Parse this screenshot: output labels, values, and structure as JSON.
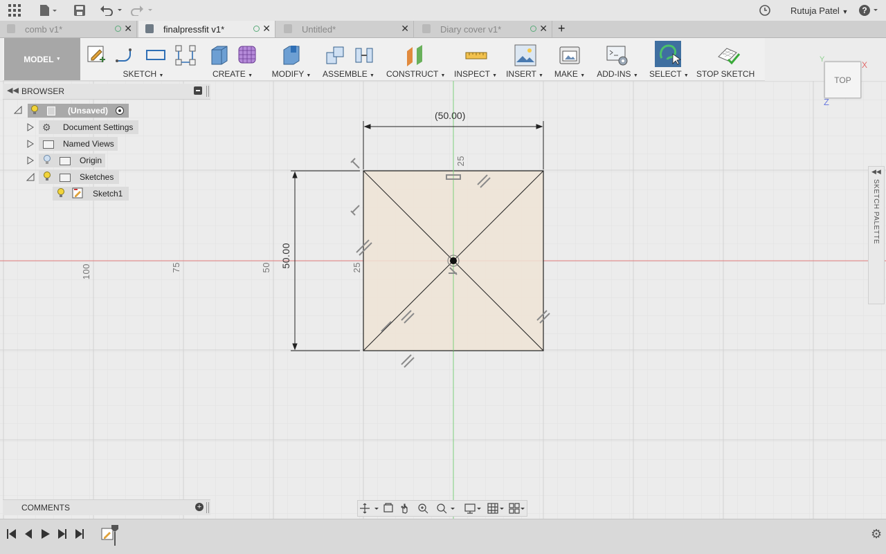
{
  "topbar": {
    "user_name": "Rutuja Patel",
    "icons": [
      "grid-apps-icon",
      "file-icon",
      "save-icon",
      "undo-icon",
      "redo-icon",
      "clock-icon",
      "help-icon"
    ]
  },
  "tabs": [
    {
      "label": "comb v1*",
      "active": false
    },
    {
      "label": "finalpressfit v1*",
      "active": true
    },
    {
      "label": "Untitled*",
      "active": false
    },
    {
      "label": "Diary cover v1*",
      "active": false
    }
  ],
  "toolbar": {
    "workspace": "MODEL",
    "groups": {
      "sketch": "SKETCH",
      "create": "CREATE",
      "modify": "MODIFY",
      "assemble": "ASSEMBLE",
      "construct": "CONSTRUCT",
      "inspect": "INSPECT",
      "insert": "INSERT",
      "make": "MAKE",
      "addins": "ADD-INS",
      "select": "SELECT",
      "stop_sketch": "STOP SKETCH"
    }
  },
  "browser": {
    "title": "BROWSER",
    "root": "(Unsaved)",
    "items": [
      "Document Settings",
      "Named Views",
      "Origin",
      "Sketches",
      "Sketch1"
    ]
  },
  "comments": {
    "title": "COMMENTS"
  },
  "viewcube": {
    "face": "TOP",
    "axes": {
      "x": "X",
      "y": "Y",
      "z": "Z"
    }
  },
  "sketch_palette": {
    "label": "SKETCH PALETTE"
  },
  "canvas": {
    "dim_top": "(50.00)",
    "dim_left": "50.00",
    "ruler_h": [
      "100",
      "75",
      "50",
      "25"
    ],
    "ruler_v": "25"
  },
  "colors": {
    "sketch_fill": "#efe4d6",
    "x_axis": "#e07a7a",
    "y_axis": "#7ccf7c",
    "select_active": "#3f6fa0"
  }
}
